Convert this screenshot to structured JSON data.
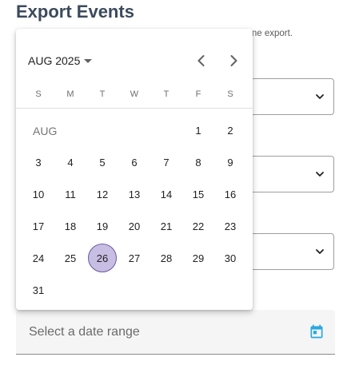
{
  "page": {
    "title": "Export Events",
    "hint_text": "ne export."
  },
  "date_field": {
    "placeholder": "Select a date range"
  },
  "calendar": {
    "period_label": "AUG 2025",
    "month_label": "AUG",
    "weekdays": [
      "S",
      "M",
      "T",
      "W",
      "T",
      "F",
      "S"
    ],
    "days": [
      {
        "label": "1",
        "week": 0,
        "col": 5
      },
      {
        "label": "2",
        "week": 0,
        "col": 6
      },
      {
        "label": "3",
        "week": 1,
        "col": 0
      },
      {
        "label": "4",
        "week": 1,
        "col": 1
      },
      {
        "label": "5",
        "week": 1,
        "col": 2
      },
      {
        "label": "6",
        "week": 1,
        "col": 3
      },
      {
        "label": "7",
        "week": 1,
        "col": 4
      },
      {
        "label": "8",
        "week": 1,
        "col": 5
      },
      {
        "label": "9",
        "week": 1,
        "col": 6
      },
      {
        "label": "10",
        "week": 2,
        "col": 0
      },
      {
        "label": "11",
        "week": 2,
        "col": 1
      },
      {
        "label": "12",
        "week": 2,
        "col": 2
      },
      {
        "label": "13",
        "week": 2,
        "col": 3
      },
      {
        "label": "14",
        "week": 2,
        "col": 4
      },
      {
        "label": "15",
        "week": 2,
        "col": 5
      },
      {
        "label": "16",
        "week": 2,
        "col": 6
      },
      {
        "label": "17",
        "week": 3,
        "col": 0
      },
      {
        "label": "18",
        "week": 3,
        "col": 1
      },
      {
        "label": "19",
        "week": 3,
        "col": 2
      },
      {
        "label": "20",
        "week": 3,
        "col": 3
      },
      {
        "label": "21",
        "week": 3,
        "col": 4
      },
      {
        "label": "22",
        "week": 3,
        "col": 5
      },
      {
        "label": "23",
        "week": 3,
        "col": 6
      },
      {
        "label": "24",
        "week": 4,
        "col": 0
      },
      {
        "label": "25",
        "week": 4,
        "col": 1
      },
      {
        "label": "26",
        "week": 4,
        "col": 2,
        "selected": true
      },
      {
        "label": "27",
        "week": 4,
        "col": 3
      },
      {
        "label": "28",
        "week": 4,
        "col": 4
      },
      {
        "label": "29",
        "week": 4,
        "col": 5
      },
      {
        "label": "30",
        "week": 4,
        "col": 6
      },
      {
        "label": "31",
        "week": 5,
        "col": 0
      }
    ]
  },
  "icons": {
    "prev": "chevron-left-icon",
    "next": "chevron-right-icon",
    "select_chevron": "chevron-down-icon",
    "calendar": "calendar-icon"
  },
  "colors": {
    "selected_day_fill": "#c8bde3",
    "selected_day_border": "#6b5a9c",
    "calendar_icon": "#29a8e0",
    "title": "#3b4a5c"
  }
}
